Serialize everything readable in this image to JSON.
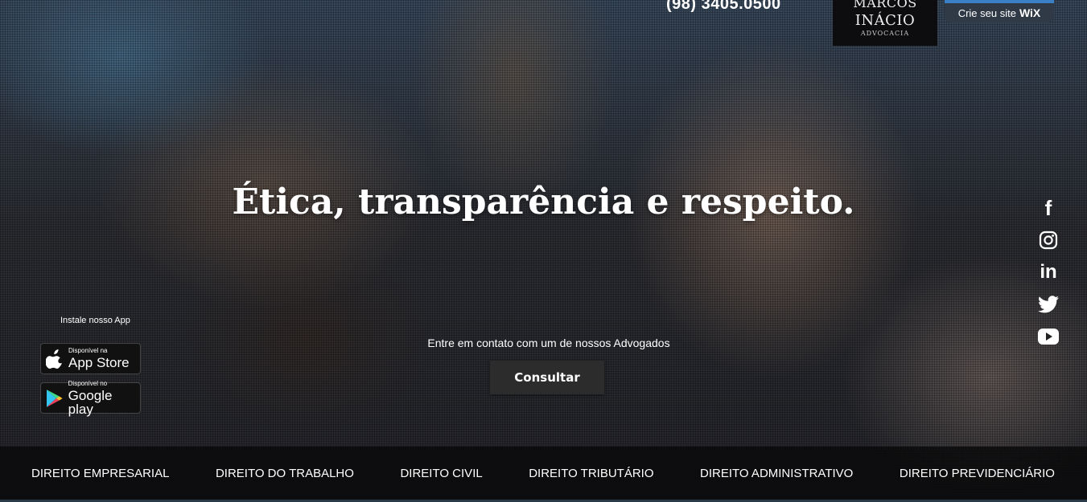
{
  "header": {
    "phone": "(98) 3405.0500",
    "logo": {
      "line1": "MARCOS",
      "line2": "INÁCIO",
      "line3": "ADVOCACIA"
    },
    "wix_banner": {
      "label": "Crie seu site",
      "brand": "WiX"
    }
  },
  "hero": {
    "headline": "Ética, transparência e respeito.",
    "contact_text": "Entre em contato com um de nossos Advogados",
    "consult_button": "Consultar"
  },
  "app": {
    "title": "Instale nosso App",
    "app_store": {
      "small": "Disponível na",
      "big": "App Store"
    },
    "google_play": {
      "small": "Disponível no",
      "big": "Google play"
    }
  },
  "social": [
    {
      "name": "facebook-icon",
      "glyph": "f"
    },
    {
      "name": "instagram-icon",
      "glyph": ""
    },
    {
      "name": "linkedin-icon",
      "glyph": "in"
    },
    {
      "name": "twitter-icon",
      "glyph": ""
    },
    {
      "name": "youtube-icon",
      "glyph": ""
    }
  ],
  "nav": {
    "items": [
      "DIREITO EMPRESARIAL",
      "DIREITO DO TRABALHO",
      "DIREITO CIVIL",
      "DIREITO TRIBUTÁRIO",
      "DIREITO ADMINISTRATIVO",
      "DIREITO PREVIDENCIÁRIO"
    ]
  }
}
